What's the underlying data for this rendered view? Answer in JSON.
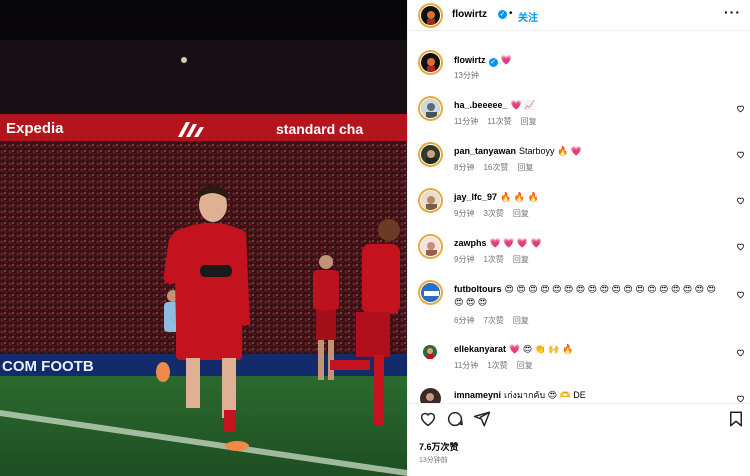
{
  "post": {
    "sponsor_board": "Expedia",
    "sponsor_board_right": "standard cha",
    "adboard_bottom": "COM FOOTB"
  },
  "header": {
    "username": "flowirtz",
    "separator": "•",
    "follow_label": "关注",
    "more_label": "···"
  },
  "caption": {
    "username": "flowirtz",
    "text": "💗",
    "time": "13分钟"
  },
  "comments": [
    {
      "user": "ha_.beeeee_",
      "text": "💗 📈",
      "time": "11分钟",
      "likes": "11次赞",
      "reply": "回复"
    },
    {
      "user": "pan_tanyawan",
      "text": "Starboyy 🔥 💗",
      "time": "8分钟",
      "likes": "16次赞",
      "reply": "回复"
    },
    {
      "user": "jay_lfc_97",
      "text": "🔥 🔥 🔥",
      "time": "9分钟",
      "likes": "3次赞",
      "reply": "回复"
    },
    {
      "user": "zawphs",
      "text": "💗 💗 💗 💗",
      "time": "9分钟",
      "likes": "1次赞",
      "reply": "回复"
    },
    {
      "user": "futboltours",
      "text": "😍 😍 😍 😍 😍 😍 😍 😍 😍 😍 😍 😍 😍 😍 😍 😍 😍 😍 😍 😍 😍",
      "time": "6分钟",
      "likes": "7次赞",
      "reply": "回复"
    },
    {
      "user": "ellekanyarat",
      "text": "💗 😍 👏 🙌 🔥",
      "time": "11分钟",
      "likes": "1次赞",
      "reply": "回复"
    },
    {
      "user": "imnameyni",
      "text": "เก่งมากคับ 😍 🫶 DE",
      "time": "",
      "likes": "",
      "reply": ""
    }
  ],
  "footer": {
    "likes": "7.6万次赞",
    "time": "13分钟前"
  },
  "colors": {
    "link": "#0095f6",
    "meta": "#737373",
    "heart": "#ed4956",
    "story_ring": "#e6a93b"
  }
}
